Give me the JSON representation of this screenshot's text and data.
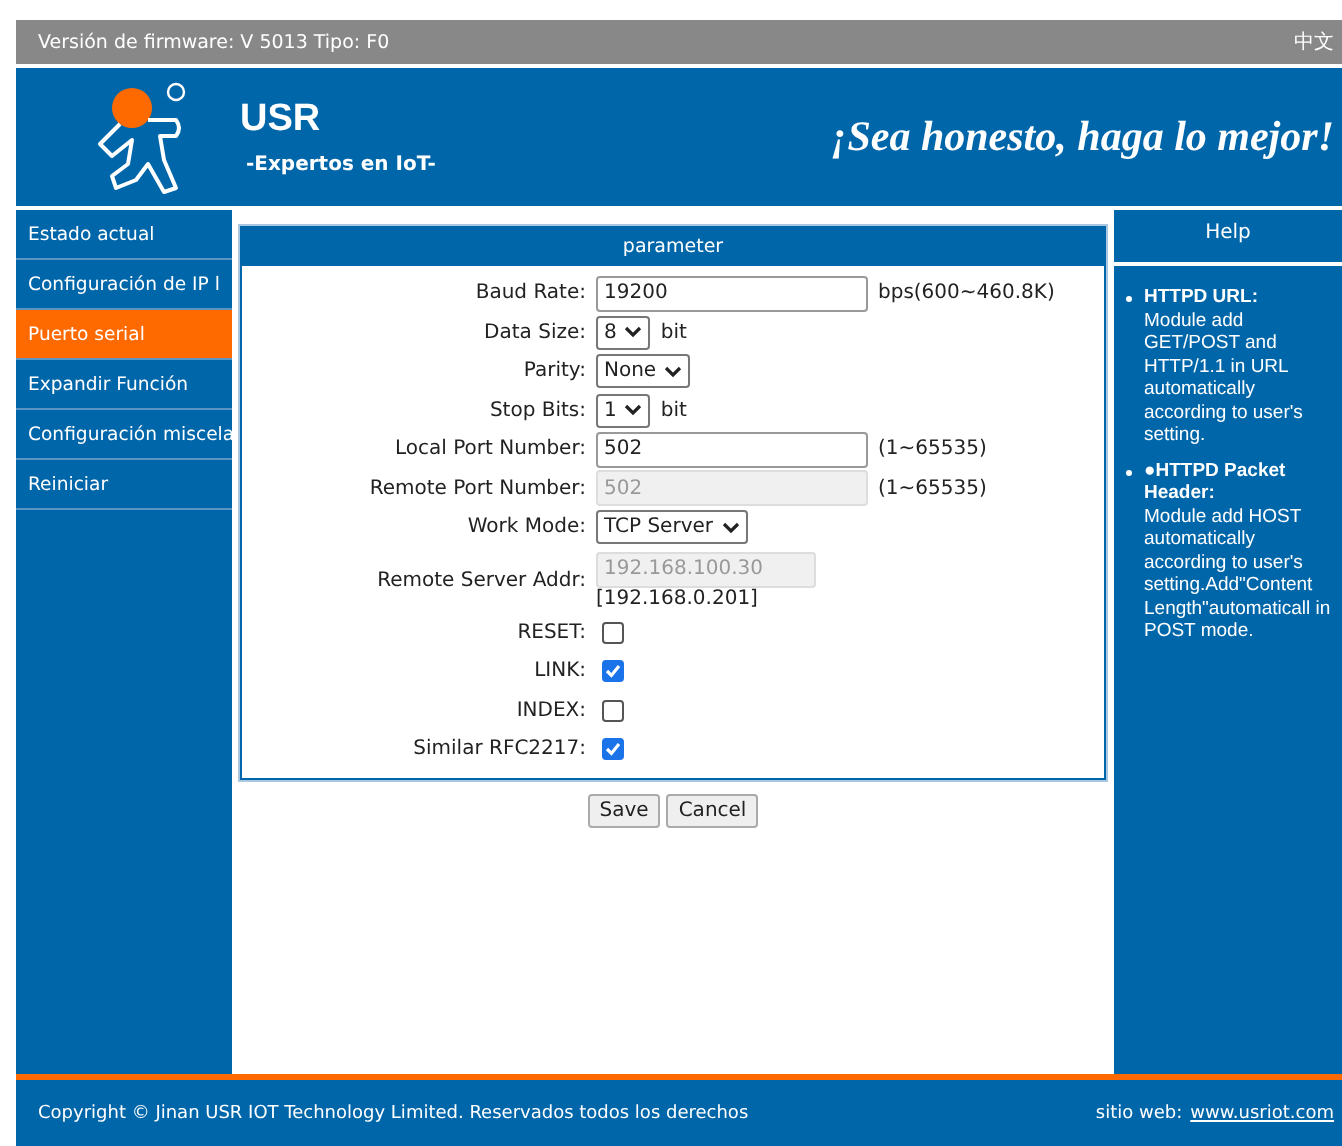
{
  "top_bar": {
    "firmware": "Versión de firmware: V 5013 Tipo: F0",
    "language": "中文"
  },
  "header": {
    "brand": "USR",
    "tagline": "-Expertos en IoT-",
    "slogan": "¡Sea honesto, haga lo mejor!"
  },
  "sidebar": {
    "items": [
      {
        "label": "Estado actual",
        "selected": false
      },
      {
        "label": "Configuración de IP l",
        "selected": false
      },
      {
        "label": "Puerto serial",
        "selected": true
      },
      {
        "label": "Expandir Función",
        "selected": false
      },
      {
        "label": "Configuración miscela",
        "selected": false
      },
      {
        "label": "Reiniciar",
        "selected": false
      }
    ]
  },
  "form": {
    "title": "parameter",
    "fields": [
      {
        "kind": "text",
        "label": "Baud Rate:",
        "value": "19200",
        "unit": "bps(600~460.8K)",
        "disabled": false
      },
      {
        "kind": "select",
        "label": "Data Size:",
        "value": "8",
        "unit": "bit"
      },
      {
        "kind": "select",
        "label": "Parity:",
        "value": "None"
      },
      {
        "kind": "select",
        "label": "Stop Bits:",
        "value": "1",
        "unit": "bit"
      },
      {
        "kind": "text",
        "label": "Local Port Number:",
        "value": "502",
        "unit": "(1~65535)",
        "disabled": false
      },
      {
        "kind": "text",
        "label": "Remote Port Number:",
        "value": "502",
        "unit": "(1~65535)",
        "disabled": true
      },
      {
        "kind": "select",
        "label": "Work Mode:",
        "value": "TCP Server"
      },
      {
        "kind": "addr",
        "label": "Remote Server Addr:",
        "value": "192.168.100.30",
        "note": "[192.168.0.201]",
        "disabled": true
      },
      {
        "kind": "checkbox",
        "label": "RESET:",
        "checked": false
      },
      {
        "kind": "checkbox",
        "label": "LINK:",
        "checked": true
      },
      {
        "kind": "checkbox",
        "label": "INDEX:",
        "checked": false
      },
      {
        "kind": "checkbox",
        "label": "Similar RFC2217:",
        "checked": true
      }
    ],
    "buttons": [
      "Save",
      "Cancel"
    ]
  },
  "help": {
    "title": "Help",
    "items": [
      {
        "heading": "HTTPD URL:",
        "text": "Module add GET/POST and HTTP/1.1 in URL automatically according to user's setting."
      },
      {
        "heading": "●HTTPD Packet Header:",
        "text": "Module add HOST automatically according to user's setting.Add\"Content Length\"automaticall in POST mode."
      }
    ]
  },
  "footer": {
    "copyright": "Copyright © Jinan USR IOT Technology Limited. Reservados todos los derechos",
    "site_label": "sitio web:",
    "site_link": "www.usriot.com"
  }
}
